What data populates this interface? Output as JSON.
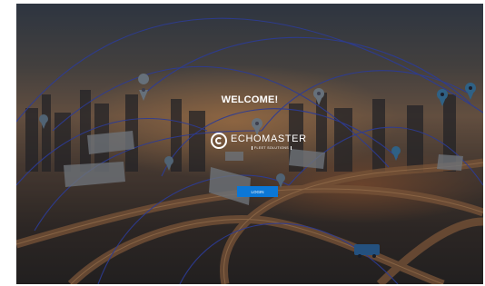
{
  "hero": {
    "welcome_title": "WELCOME!",
    "brand_name": "ECHOMASTER",
    "brand_tagline": "FLEET SOLUTIONS",
    "login_label": "LOGIN"
  },
  "colors": {
    "login_button": "#0b77d6",
    "network_lines": "#3a4fd0",
    "title_text": "#ffffff"
  },
  "icons": [
    "map-pin-icon",
    "echomaster-logo-icon"
  ]
}
